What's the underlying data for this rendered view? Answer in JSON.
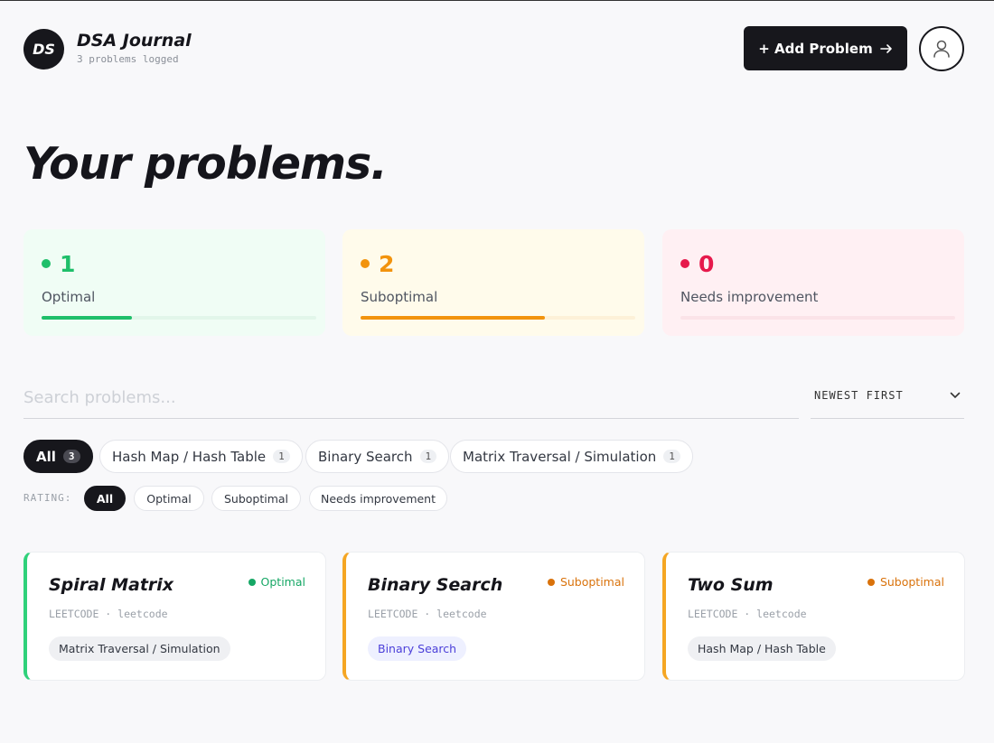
{
  "header": {
    "logo_text": "DS",
    "app_title": "DSA Journal",
    "subtitle": "3 problems logged",
    "add_button": "+ Add Problem",
    "avatar_icon": "user-icon"
  },
  "page_title": "Your problems.",
  "stats": [
    {
      "count": "1",
      "label": "Optimal",
      "color": "#1fbf6a",
      "bg": "#f0fdf5",
      "track": "#e2f6ea",
      "fraction": 0.33
    },
    {
      "count": "2",
      "label": "Suboptimal",
      "color": "#f2930d",
      "bg": "#fffbeb",
      "track": "#fdf1d8",
      "fraction": 0.67
    },
    {
      "count": "0",
      "label": "Needs improvement",
      "color": "#e6194b",
      "bg": "#fff0f3",
      "track": "#fbe3e8",
      "fraction": 0
    }
  ],
  "search": {
    "placeholder": "Search problems..."
  },
  "sort": {
    "value": "NEWEST FIRST"
  },
  "categories": [
    {
      "label": "All",
      "count": "3",
      "active": true
    },
    {
      "label": "Hash Map / Hash Table",
      "count": "1"
    },
    {
      "label": "Binary Search",
      "count": "1"
    },
    {
      "label": "Matrix Traversal / Simulation",
      "count": "1"
    }
  ],
  "rating": {
    "label": "RATING:",
    "options": [
      "All",
      "Optimal",
      "Suboptimal",
      "Needs improvement"
    ]
  },
  "problems": [
    {
      "title": "Spiral Matrix",
      "status": "Optimal",
      "status_color": "#16a765",
      "accent": "#2fd17a",
      "source": "LEETCODE · leetcode",
      "tag": "Matrix Traversal / Simulation",
      "tag_style": "gray"
    },
    {
      "title": "Binary Search",
      "status": "Suboptimal",
      "status_color": "#d9720b",
      "accent": "#f5a623",
      "source": "LEETCODE · leetcode",
      "tag": "Binary Search",
      "tag_style": "blue"
    },
    {
      "title": "Two Sum",
      "status": "Suboptimal",
      "status_color": "#d9720b",
      "accent": "#f5a623",
      "source": "LEETCODE · leetcode",
      "tag": "Hash Map / Hash Table",
      "tag_style": "gray"
    }
  ]
}
